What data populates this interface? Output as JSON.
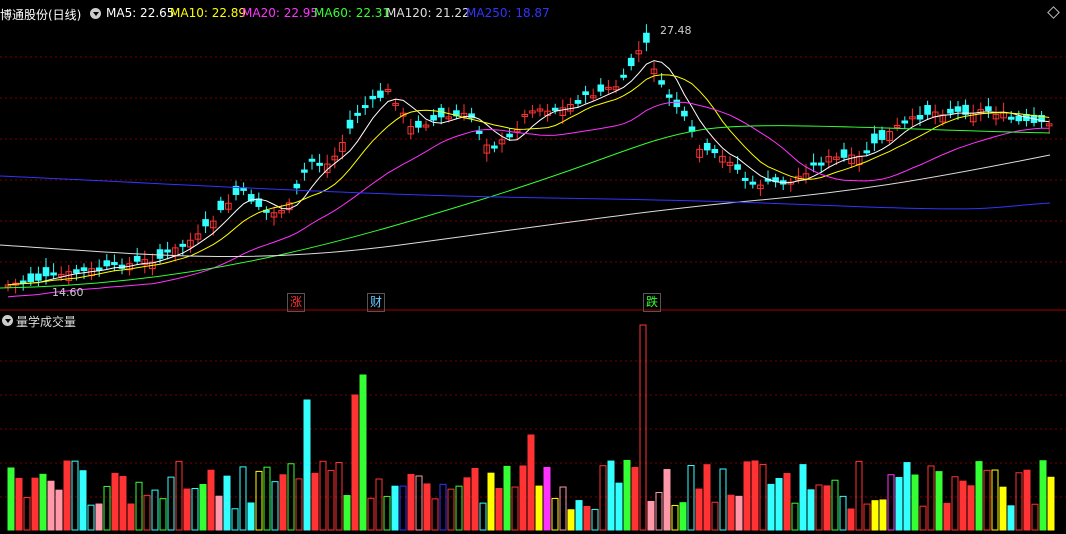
{
  "header": {
    "title": "博通股份(日线)",
    "ma": [
      {
        "label": "MA5: 22.65",
        "color": "#ffffff"
      },
      {
        "label": "MA10: 22.89",
        "color": "#ffff00"
      },
      {
        "label": "MA20: 22.95",
        "color": "#ff33ff"
      },
      {
        "label": "MA60: 22.31",
        "color": "#33ff33"
      },
      {
        "label": "MA120: 21.22",
        "color": "#dddddd"
      },
      {
        "label": "MA250: 18.87",
        "color": "#3333ff"
      }
    ]
  },
  "annotations": {
    "high": "27.48",
    "low": "14.60"
  },
  "markers": [
    {
      "text": "涨",
      "color": "#ff3333"
    },
    {
      "text": "财",
      "color": "#66ccff"
    },
    {
      "text": "跌",
      "color": "#33ff33"
    }
  ],
  "volume_panel": {
    "title": "量学成交量"
  },
  "colors": {
    "up": "#ff3333",
    "down": "#33ffff",
    "grid": "#7a0000",
    "divider": "#aa0000"
  }
}
